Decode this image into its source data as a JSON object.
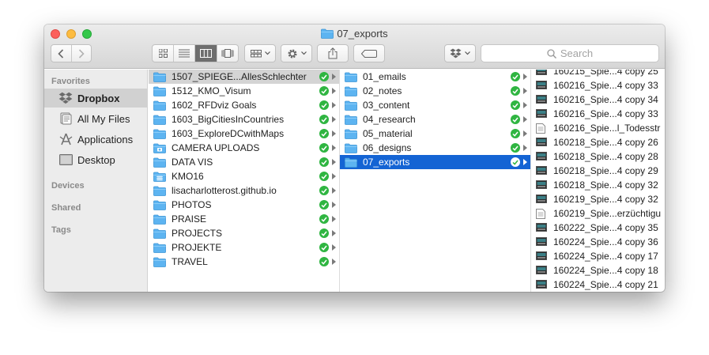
{
  "window": {
    "title": "07_exports"
  },
  "toolbar": {
    "search_placeholder": "Search"
  },
  "sidebar": {
    "sections": [
      "Favorites",
      "Devices",
      "Shared",
      "Tags"
    ],
    "items": [
      {
        "label": "Dropbox",
        "icon": "dropbox-icon",
        "selected": true
      },
      {
        "label": "All My Files",
        "icon": "all-files-icon"
      },
      {
        "label": "Applications",
        "icon": "applications-icon"
      },
      {
        "label": "Desktop",
        "icon": "desktop-icon"
      }
    ]
  },
  "column1": [
    {
      "name": "1507_SPIEGE...AllesSchlechter",
      "icon": "folder-icon"
    },
    {
      "name": "1512_KMO_Visum",
      "icon": "folder-icon"
    },
    {
      "name": "1602_RFDviz Goals",
      "icon": "folder-icon"
    },
    {
      "name": "1603_BigCitiesInCountries",
      "icon": "folder-icon"
    },
    {
      "name": "1603_ExploreDCwithMaps",
      "icon": "folder-icon"
    },
    {
      "name": "CAMERA UPLOADS",
      "icon": "camera-folder-icon"
    },
    {
      "name": "DATA VIS",
      "icon": "folder-icon"
    },
    {
      "name": "KMO16",
      "icon": "grid-folder-icon"
    },
    {
      "name": "lisacharlotterost.github.io",
      "icon": "folder-icon"
    },
    {
      "name": "PHOTOS",
      "icon": "folder-icon"
    },
    {
      "name": "PRAISE",
      "icon": "folder-icon"
    },
    {
      "name": "PROJECTS",
      "icon": "folder-icon"
    },
    {
      "name": "PROJEKTE",
      "icon": "folder-icon"
    },
    {
      "name": "TRAVEL",
      "icon": "folder-icon"
    }
  ],
  "column2": [
    {
      "name": "01_emails"
    },
    {
      "name": "02_notes"
    },
    {
      "name": "03_content"
    },
    {
      "name": "04_research"
    },
    {
      "name": "05_material"
    },
    {
      "name": "06_designs"
    },
    {
      "name": "07_exports"
    }
  ],
  "column3": [
    {
      "name": "160215_Spie...4 copy 25",
      "icon": "image-file-icon"
    },
    {
      "name": "160216_Spie...4 copy 33",
      "icon": "image-file-icon"
    },
    {
      "name": "160216_Spie...4 copy 34",
      "icon": "image-file-icon"
    },
    {
      "name": "160216_Spie...4 copy 33",
      "icon": "image-file-icon"
    },
    {
      "name": "160216_Spie...l_Todesstr",
      "icon": "document-file-icon"
    },
    {
      "name": "160218_Spie...4 copy 26",
      "icon": "image-file-icon"
    },
    {
      "name": "160218_Spie...4 copy 28",
      "icon": "image-file-icon"
    },
    {
      "name": "160218_Spie...4 copy 29",
      "icon": "image-file-icon"
    },
    {
      "name": "160218_Spie...4 copy 32",
      "icon": "image-file-icon"
    },
    {
      "name": "160219_Spie...4 copy 32",
      "icon": "image-file-icon"
    },
    {
      "name": "160219_Spie...erzüchtigu",
      "icon": "document-file-icon"
    },
    {
      "name": "160222_Spie...4 copy 35",
      "icon": "image-file-icon"
    },
    {
      "name": "160224_Spie...4 copy 36",
      "icon": "image-file-icon"
    },
    {
      "name": "160224_Spie...4 copy 17",
      "icon": "image-file-icon"
    },
    {
      "name": "160224_Spie...4 copy 18",
      "icon": "image-file-icon"
    },
    {
      "name": "160224_Spie...4 copy 21",
      "icon": "image-file-icon"
    }
  ],
  "colors": {
    "selection_blue": "#1464d4",
    "sync_green": "#2fb541",
    "folder_blue": "#5db4f1"
  }
}
